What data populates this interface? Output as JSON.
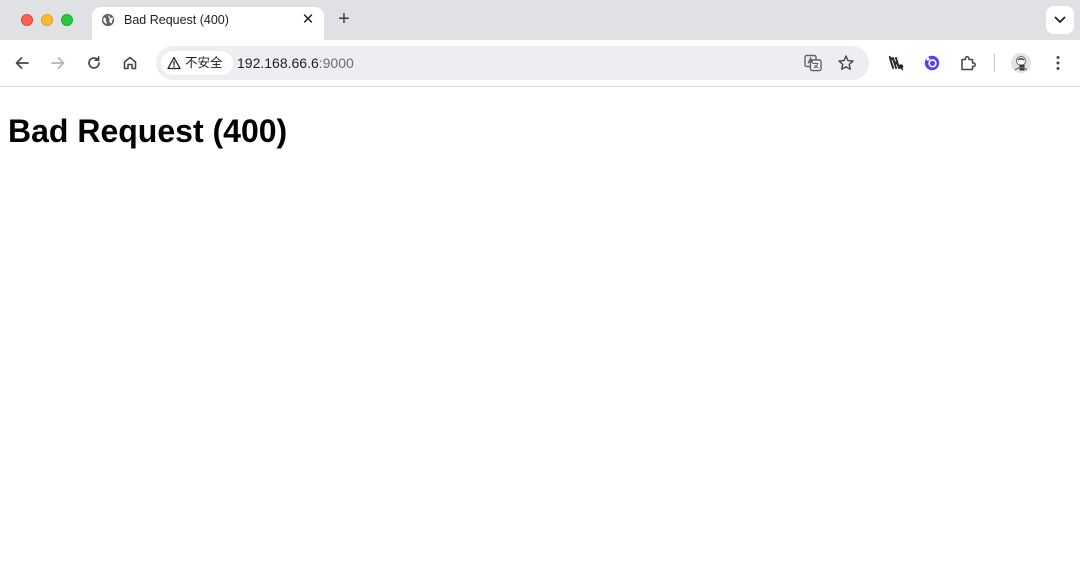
{
  "tab": {
    "title": "Bad Request (400)",
    "close_glyph": "✕",
    "favicon": "globe-icon"
  },
  "tabstrip": {
    "new_tab_glyph": "+"
  },
  "omnibox": {
    "security_label": "不安全",
    "security_icon": "warning-triangle-icon",
    "url_host": "192.168.66.6",
    "url_port": ":9000"
  },
  "page": {
    "heading": "Bad Request (400)"
  },
  "colors": {
    "tabstrip_bg": "#dfe1e5",
    "omnibox_bg": "#edeef1",
    "traffic_close": "#ff5f57",
    "traffic_min": "#febc2e",
    "traffic_max": "#28c840",
    "extension_accent": "#5b3df5"
  }
}
